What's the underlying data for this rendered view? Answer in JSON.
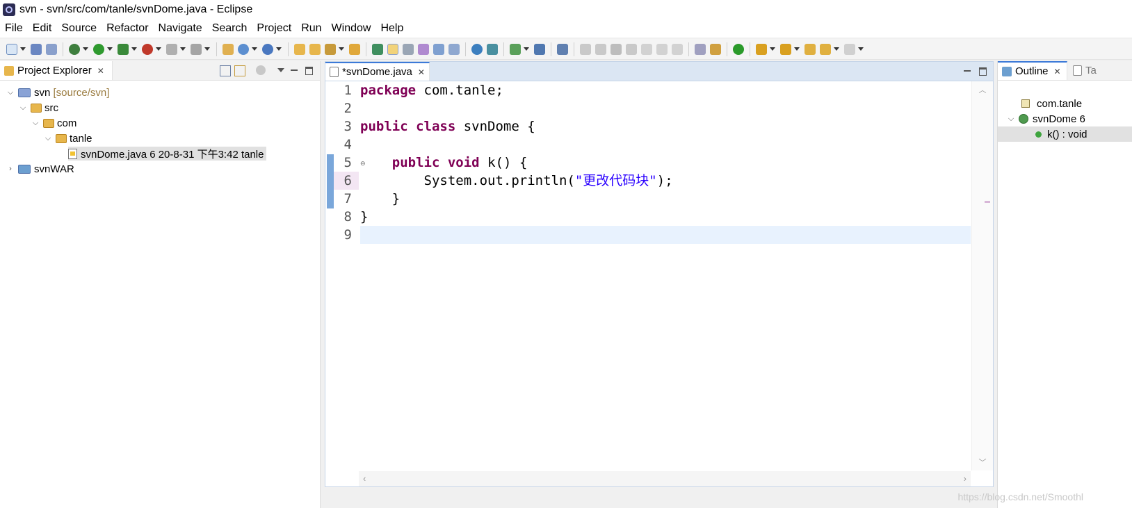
{
  "window": {
    "title": "svn - svn/src/com/tanle/svnDome.java - Eclipse"
  },
  "menu": [
    "File",
    "Edit",
    "Source",
    "Refactor",
    "Navigate",
    "Search",
    "Project",
    "Run",
    "Window",
    "Help"
  ],
  "left_view": {
    "tab_label": "Project Explorer",
    "tree": {
      "project": {
        "name": "svn",
        "decoration": "[source/svn]"
      },
      "src": "src",
      "com": "com",
      "tanle": "tanle",
      "file": "svnDome.java 6  20-8-31 下午3:42  tanle",
      "project2": "svnWAR"
    }
  },
  "editor": {
    "tab_label": "*svnDome.java",
    "line_numbers": [
      "1",
      "2",
      "3",
      "4",
      "5",
      "6",
      "7",
      "8",
      "9"
    ],
    "code": {
      "l1_kw": "package",
      "l1_rest": " com.tanle;",
      "l3_kw1": "public",
      "l3_kw2": "class",
      "l3_rest": " svnDome {",
      "l5_indent": "    ",
      "l5_kw1": "public",
      "l5_kw2": "void",
      "l5_rest": " k() {",
      "l6_indent": "        ",
      "l6_pre": "System.out.println(",
      "l6_str": "\"更改代码块\"",
      "l6_post": ");",
      "l7": "    }",
      "l8": "}"
    }
  },
  "right_view": {
    "tab_label": "Outline",
    "tab2_label": "Ta",
    "items": {
      "package": "com.tanle",
      "class": "svnDome 6",
      "method": "k() : void"
    }
  },
  "watermark": "https://blog.csdn.net/Smoothl"
}
